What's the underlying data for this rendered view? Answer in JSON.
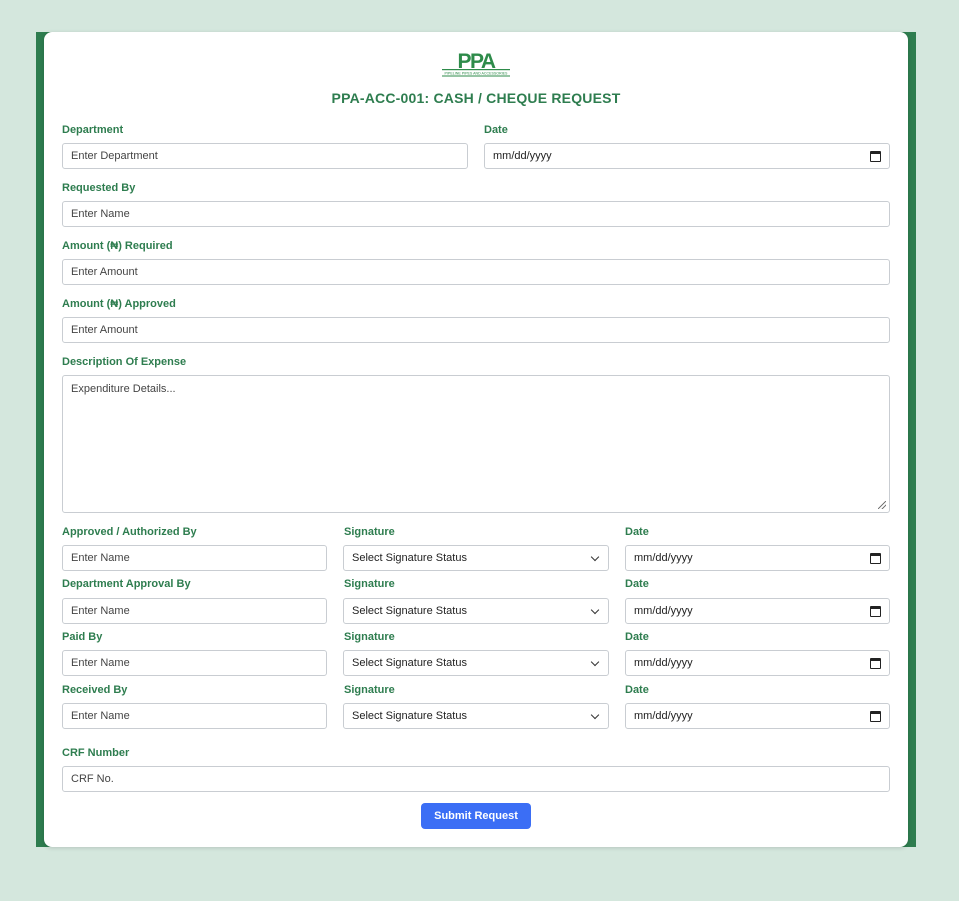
{
  "logo": {
    "text": "PPA",
    "tagline": "PIPELINE PIPES AND ACCESSORIES",
    "brand_color": "#2e8b4a"
  },
  "form": {
    "title": "PPA-ACC-001: CASH / CHEQUE REQUEST",
    "department": {
      "label": "Department",
      "placeholder": "Enter Department"
    },
    "date": {
      "label": "Date",
      "placeholder": "mm/dd/yyyy"
    },
    "requested_by": {
      "label": "Requested By",
      "placeholder": "Enter Name"
    },
    "amount_required": {
      "label": "Amount (₦) Required",
      "placeholder": "Enter Amount"
    },
    "amount_approved": {
      "label": "Amount (₦) Approved",
      "placeholder": "Enter Amount"
    },
    "description": {
      "label": "Description Of Expense",
      "placeholder": "Expenditure Details..."
    },
    "signature_rows": [
      {
        "label": "Approved / Authorized By",
        "name_placeholder": "Enter Name",
        "signature_label": "Signature",
        "signature_value": "Select Signature Status",
        "date_label": "Date",
        "date_placeholder": "mm/dd/yyyy"
      },
      {
        "label": "Department Approval By",
        "name_placeholder": "Enter Name",
        "signature_label": "Signature",
        "signature_value": "Select Signature Status",
        "date_label": "Date",
        "date_placeholder": "mm/dd/yyyy"
      },
      {
        "label": "Paid By",
        "name_placeholder": "Enter Name",
        "signature_label": "Signature",
        "signature_value": "Select Signature Status",
        "date_label": "Date",
        "date_placeholder": "mm/dd/yyyy"
      },
      {
        "label": "Received By",
        "name_placeholder": "Enter Name",
        "signature_label": "Signature",
        "signature_value": "Select Signature Status",
        "date_label": "Date",
        "date_placeholder": "mm/dd/yyyy"
      }
    ],
    "crf_number": {
      "label": "CRF Number",
      "placeholder": "CRF No."
    },
    "submit_label": "Submit Request"
  },
  "colors": {
    "accent": "#2e7d4f",
    "background": "#d4e7dd",
    "button": "#3b6ef5"
  }
}
